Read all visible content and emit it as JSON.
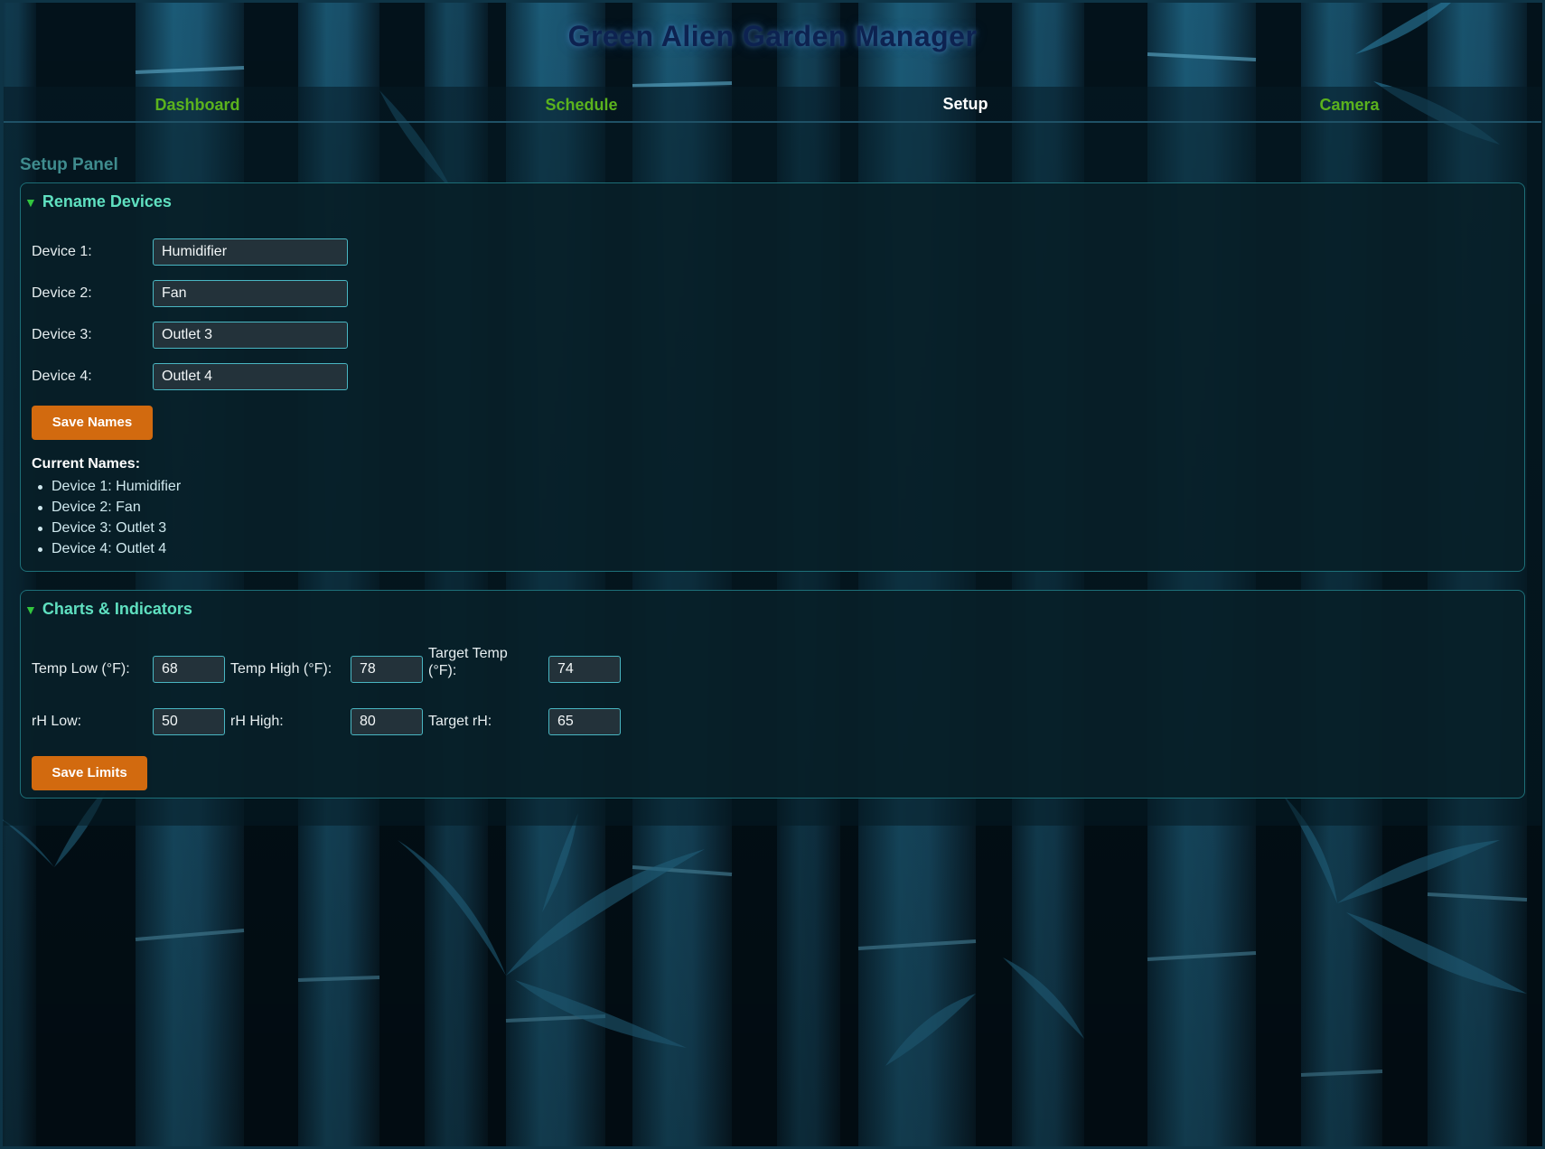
{
  "app": {
    "title": "Green Alien Garden Manager"
  },
  "nav": {
    "tabs": [
      {
        "label": "Dashboard",
        "active": false
      },
      {
        "label": "Schedule",
        "active": false
      },
      {
        "label": "Setup",
        "active": true
      },
      {
        "label": "Camera",
        "active": false
      }
    ]
  },
  "panel": {
    "title": "Setup Panel"
  },
  "rename": {
    "heading": "Rename Devices",
    "fields": [
      {
        "label": "Device 1:",
        "value": "Humidifier"
      },
      {
        "label": "Device 2:",
        "value": "Fan"
      },
      {
        "label": "Device 3:",
        "value": "Outlet 3"
      },
      {
        "label": "Device 4:",
        "value": "Outlet 4"
      }
    ],
    "save_label": "Save Names",
    "current_title": "Current Names:",
    "current": [
      "Device 1: Humidifier",
      "Device 2: Fan",
      "Device 3: Outlet 3",
      "Device 4: Outlet 4"
    ]
  },
  "charts": {
    "heading": "Charts & Indicators",
    "temp_low": {
      "label": "Temp Low (°F):",
      "value": "68"
    },
    "temp_high": {
      "label": "Temp High (°F):",
      "value": "78"
    },
    "target_temp": {
      "label_line1": "Target Temp",
      "label_line2": "(°F):",
      "value": "74"
    },
    "rh_low": {
      "label": "rH Low:",
      "value": "50"
    },
    "rh_high": {
      "label": "rH High:",
      "value": "80"
    },
    "target_rh": {
      "label": "Target rH:",
      "value": "65"
    },
    "save_label": "Save Limits"
  },
  "colors": {
    "accent_green": "#5bb21d",
    "section_heading": "#5fe0c0",
    "button_orange": "#d26a0f",
    "title_navy": "#0d2250"
  },
  "icons": {
    "section_toggle": "triangle-down-icon",
    "background": "bamboo-background"
  }
}
